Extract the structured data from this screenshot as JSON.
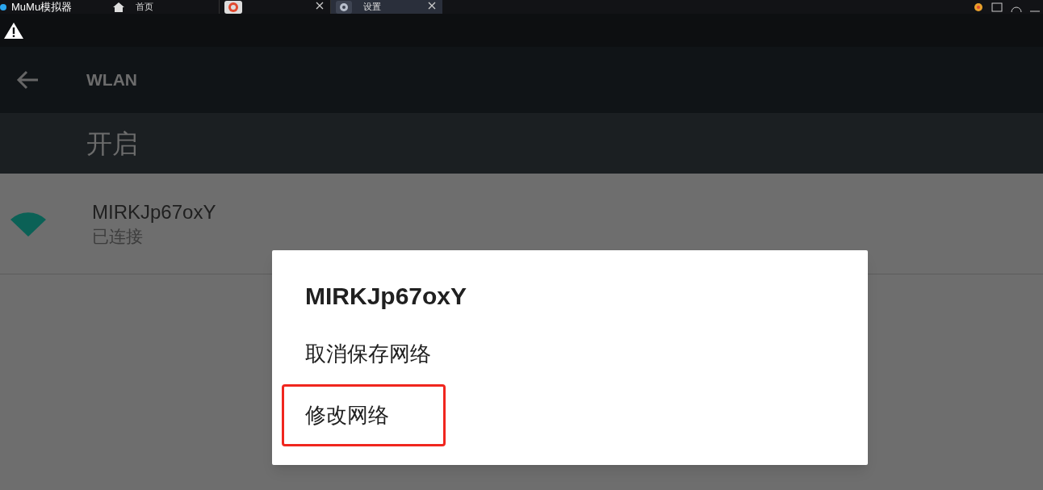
{
  "app_bar": {
    "title": "MuMu模拟器",
    "tabs": [
      {
        "kind": "home",
        "label": "首页",
        "selected": false,
        "closable": false
      },
      {
        "kind": "app",
        "selected": false,
        "closable": true
      },
      {
        "kind": "settings",
        "label": "设置",
        "selected": true,
        "closable": true
      }
    ]
  },
  "toolbar": {
    "title": "WLAN"
  },
  "switch_bar": {
    "label": "开启"
  },
  "network": {
    "name": "MIRKJp67oxY",
    "status": "已连接"
  },
  "dialog": {
    "title": "MIRKJp67oxY",
    "options": [
      {
        "label": "取消保存网络",
        "highlighted": false
      },
      {
        "label": "修改网络",
        "highlighted": true
      }
    ]
  }
}
